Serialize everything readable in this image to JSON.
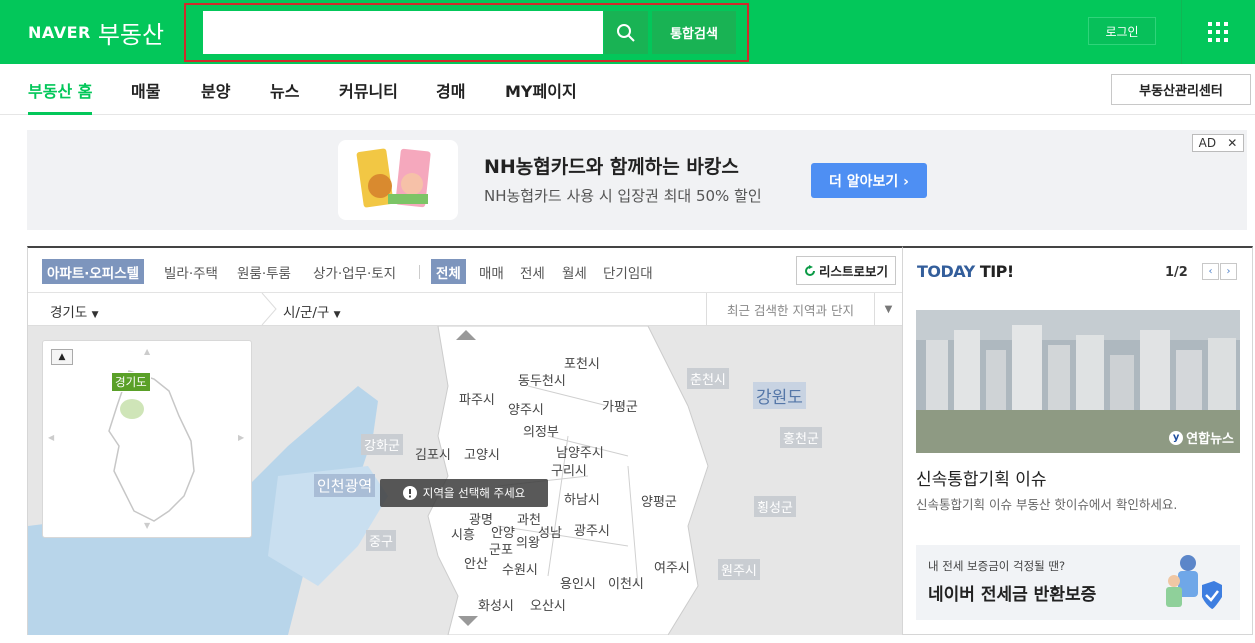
{
  "header": {
    "logo_naver": "NAVER",
    "logo_service": "부동산",
    "search_placeholder": "",
    "search_button_label": "통합검색",
    "login_label": "로그인"
  },
  "nav": {
    "items": [
      "부동산 홈",
      "매물",
      "분양",
      "뉴스",
      "커뮤니티",
      "경매",
      "MY페이지"
    ],
    "active_index": 0,
    "center_button": "부동산관리센터"
  },
  "ad": {
    "title": "NH농협카드와 함께하는 바캉스",
    "description": "NH농협카드 사용 시 입장권 최대 50% 할인",
    "cta": "더 알아보기 ›",
    "badge": "AD",
    "close": "✕"
  },
  "map_panel": {
    "property_tabs": [
      "아파트·오피스텔",
      "빌라·주택",
      "원룸·투룸",
      "상가·업무·토지"
    ],
    "property_selected": 0,
    "deal_tabs": [
      "전체",
      "매매",
      "전세",
      "월세",
      "단기임대"
    ],
    "deal_selected": 0,
    "list_button": "리스트로보기",
    "province_select": "경기도",
    "city_select": "시/군/구",
    "recent_search": "최근 검색한 지역과 단지",
    "toast": "지역을 선택해 주세요",
    "minimap_tag": "경기도",
    "regions": [
      {
        "name": "포천시"
      },
      {
        "name": "동두천시"
      },
      {
        "name": "파주시"
      },
      {
        "name": "양주시"
      },
      {
        "name": "가평군"
      },
      {
        "name": "의정부"
      },
      {
        "name": "김포시"
      },
      {
        "name": "고양시"
      },
      {
        "name": "남양주시"
      },
      {
        "name": "구리시"
      },
      {
        "name": "하남시"
      },
      {
        "name": "양평군"
      },
      {
        "name": "광명"
      },
      {
        "name": "과천"
      },
      {
        "name": "시흥"
      },
      {
        "name": "안양"
      },
      {
        "name": "성남"
      },
      {
        "name": "군포"
      },
      {
        "name": "의왕"
      },
      {
        "name": "광주시"
      },
      {
        "name": "안산"
      },
      {
        "name": "수원시"
      },
      {
        "name": "여주시"
      },
      {
        "name": "용인시"
      },
      {
        "name": "이천시"
      },
      {
        "name": "화성시"
      },
      {
        "name": "오산시"
      }
    ],
    "outer_regions": [
      "춘천시",
      "강원도",
      "홍천군",
      "강화군",
      "인천광역",
      "중구",
      "횡성군",
      "원주시"
    ]
  },
  "tip": {
    "title_a": "TODAY",
    "title_b": "TIP!",
    "page": "1/2",
    "photo_credit": "연합뉴스",
    "headline": "신속통합기획 이슈",
    "subtext": "신속통합기획 이슈 부동산 핫이슈에서 확인하세요.",
    "banner_small": "내 전세 보증금이 걱정될 땐?",
    "banner_big": "네이버 전세금 반환보증"
  },
  "colors": {
    "brand": "#03c75a",
    "accent_blue": "#4e8ff3",
    "tab_selected": "#7d95bd"
  }
}
